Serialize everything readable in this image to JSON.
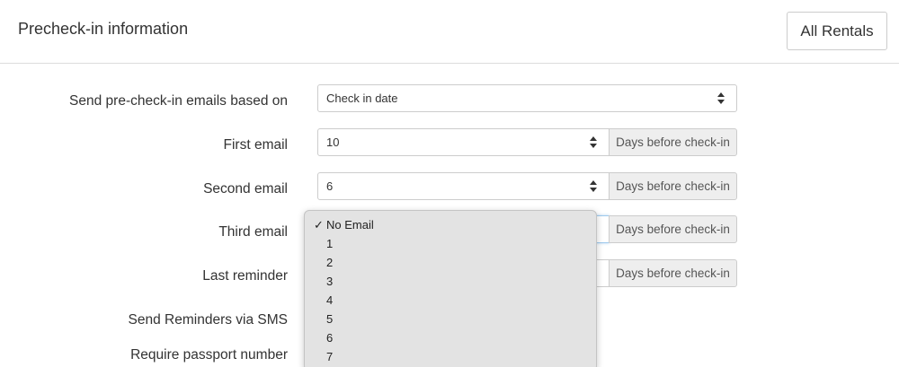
{
  "header": {
    "title": "Precheck-in information",
    "all_rentals_label": "All Rentals"
  },
  "form": {
    "send_based_on": {
      "label": "Send pre-check-in emails based on",
      "value": "Check in date"
    },
    "first_email": {
      "label": "First email",
      "value": "10",
      "addon": "Days before check-in"
    },
    "second_email": {
      "label": "Second email",
      "value": "6",
      "addon": "Days before check-in"
    },
    "third_email": {
      "label": "Third email",
      "value": "",
      "addon": "Days before check-in"
    },
    "last_reminder": {
      "label": "Last reminder",
      "addon": "Days before check-in"
    },
    "sms_reminders": {
      "label": "Send Reminders via SMS"
    },
    "passport": {
      "label": "Require passport number"
    }
  },
  "dropdown": {
    "checkmark": "✓",
    "selected_index": 0,
    "options": [
      "No Email",
      "1",
      "2",
      "3",
      "4",
      "5",
      "6",
      "7"
    ]
  },
  "icons": {
    "select_arrows": "up-down-chevron-icon",
    "check": "checkmark-icon"
  },
  "colors": {
    "addon_bg": "#eeeeee",
    "border": "#cccccc",
    "dropdown_bg": "#e3e3e3",
    "focus": "#9ecaed"
  }
}
